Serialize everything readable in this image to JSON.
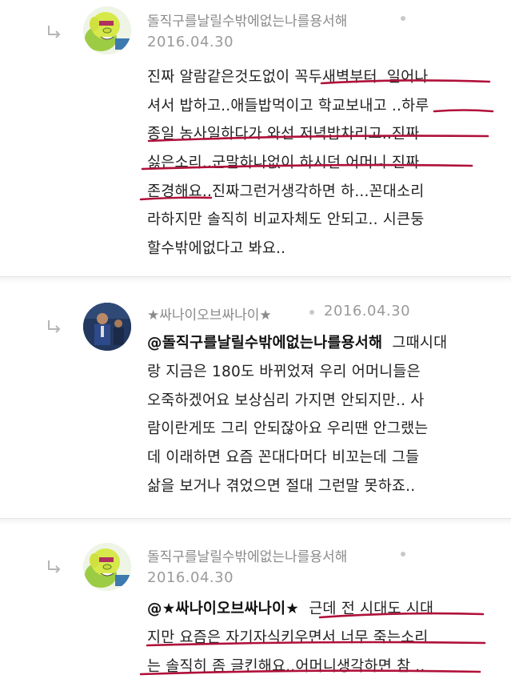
{
  "comments": [
    {
      "author": "돌직구를날릴수밖에없는나를용서해",
      "date": "2016.04.30",
      "lines": [
        "진짜 알람같은것도없이 꼭두새벽부터..일어나",
        "셔서 밥하고..애들밥먹이고 학교보내고 ..하루",
        "종일 농사일하다가 와선 저녁밥차리고..진짜",
        "싫은소리..군말하나없이 하시던 어머니 진짜",
        "존경해요..진짜그런거생각하면 하...꼰대소리",
        "라하지만 솔직히 비교자체도 안되고.. 시큰둥",
        "할수밖에없다고 봐요.."
      ]
    },
    {
      "author": "★싸나이오브싸나이★",
      "date": "2016.04.30",
      "mention": "@돌직구를날릴수밖에없는나를용서해",
      "lines": [
        "그때시대",
        "랑 지금은 180도 바뀌었져 우리 어머니들은",
        "오죽하겠어요 보상심리 가지면 안되지만..  사",
        "람이란게또 그리 안되잖아요 우리땐 안그랬는",
        "데 이래하면 요즘 꼰대다머다 비꼬는데 그들",
        "삶을 보거나 겪었으면 절대 그런말 못하죠.."
      ]
    },
    {
      "author": "돌직구를날릴수밖에없는나를용서해",
      "date": "2016.04.30",
      "mention": "@★싸나이오브싸나이★",
      "lines": [
        "근데 전 시대도 시대",
        "지만 요즘은 자기자식키우면서 너무 죽는소리",
        "는 솔직히 좀 글킨해요..어머니생각하면 참 .."
      ]
    }
  ],
  "colors": {
    "underline": "#b0103a",
    "meta": "#9a9a9a"
  },
  "icons": {
    "reply": "reply-arrow-icon"
  }
}
